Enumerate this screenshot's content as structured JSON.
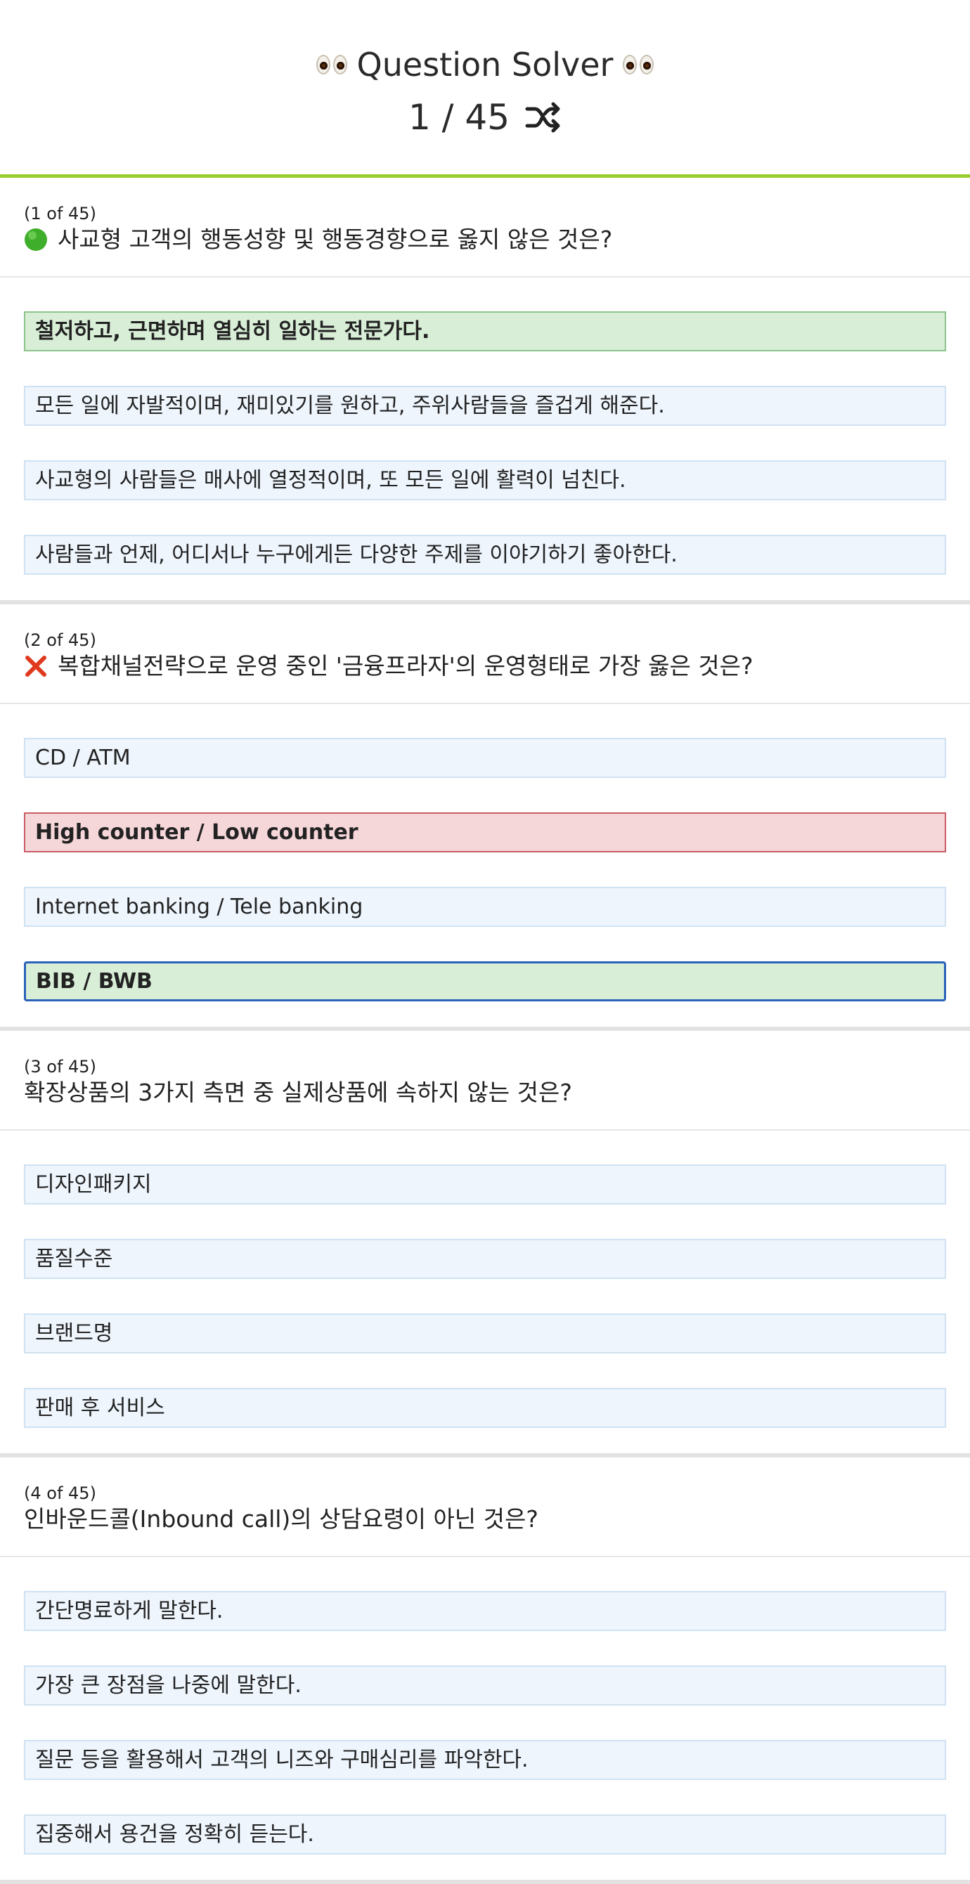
{
  "app": {
    "title": "Question Solver",
    "counter": "1 / 45"
  },
  "colors": {
    "accent": "#9acd32",
    "option_bg": "#eef5fd",
    "correct_bg": "#d8eed7",
    "wrong_bg": "#f5d6d9",
    "selected_border": "#2a62b8"
  },
  "questions": [
    {
      "num": "(1 of 45)",
      "status": "correct",
      "status_icon": "green-circle-icon",
      "text": "사교형 고객의 행동성향 및 행동경향으로 옳지 않은 것은?",
      "options": [
        {
          "label": "철저하고, 근면하며 열심히 일하는 전문가다.",
          "state": "correct"
        },
        {
          "label": "모든 일에 자발적이며, 재미있기를 원하고, 주위사람들을 즐겁게 해준다.",
          "state": "normal"
        },
        {
          "label": "사교형의 사람들은 매사에 열정적이며, 또 모든 일에 활력이 넘친다.",
          "state": "normal"
        },
        {
          "label": "사람들과 언제, 어디서나 누구에게든 다양한 주제를 이야기하기 좋아한다.",
          "state": "normal"
        }
      ]
    },
    {
      "num": "(2 of 45)",
      "status": "wrong",
      "status_icon": "red-x-icon",
      "text": "복합채널전략으로 운영 중인 '금융프라자'의 운영형태로 가장 옳은 것은?",
      "options": [
        {
          "label": "CD / ATM",
          "state": "normal"
        },
        {
          "label": "High counter / Low counter",
          "state": "wrong"
        },
        {
          "label": "Internet banking / Tele banking",
          "state": "normal"
        },
        {
          "label": "BIB / BWB",
          "state": "answer"
        }
      ]
    },
    {
      "num": "(3 of 45)",
      "status": "none",
      "text": "확장상품의 3가지 측면 중 실제상품에 속하지 않는 것은?",
      "options": [
        {
          "label": "디자인패키지",
          "state": "normal"
        },
        {
          "label": "품질수준",
          "state": "normal"
        },
        {
          "label": "브랜드명",
          "state": "normal"
        },
        {
          "label": "판매 후 서비스",
          "state": "normal"
        }
      ]
    },
    {
      "num": "(4 of 45)",
      "status": "none",
      "text": "인바운드콜(Inbound call)의 상담요령이 아닌 것은?",
      "options": [
        {
          "label": "간단명료하게 말한다.",
          "state": "normal"
        },
        {
          "label": "가장 큰 장점을 나중에 말한다.",
          "state": "normal"
        },
        {
          "label": "질문 등을 활용해서 고객의 니즈와 구매심리를 파악한다.",
          "state": "normal"
        },
        {
          "label": "집중해서 용건을 정확히 듣는다.",
          "state": "normal"
        }
      ]
    }
  ]
}
